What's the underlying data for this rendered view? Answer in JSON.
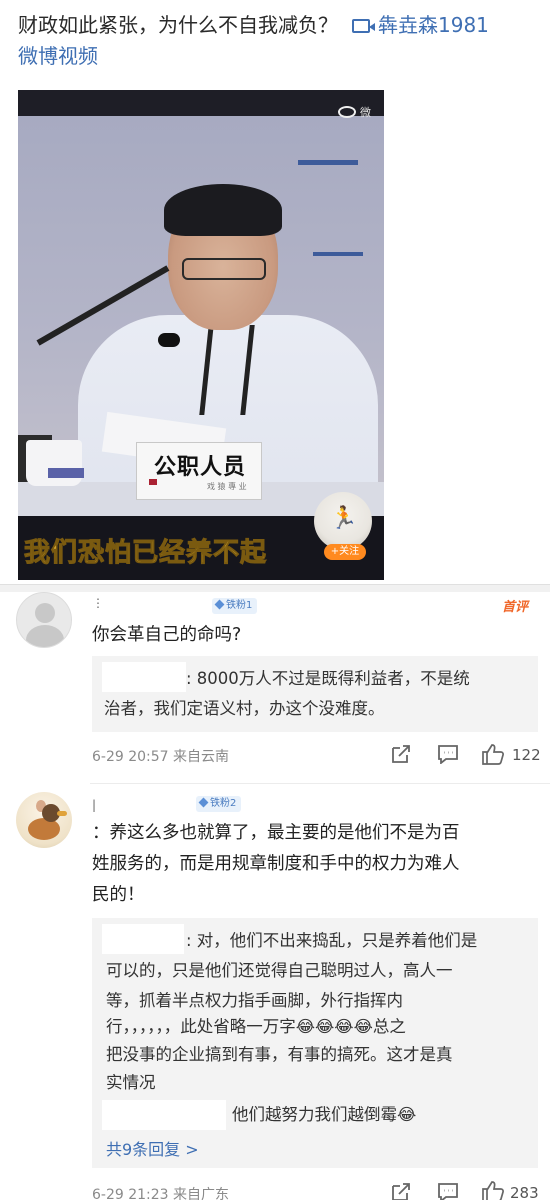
{
  "post": {
    "title": "财政如此紧张，为什么不自我减负？",
    "author": "犇垚森1981",
    "source": "微博视频",
    "video": {
      "watermark": "微",
      "nameplate": "公职人员",
      "nameplate_sub": "戏 猿 專 业",
      "subtitle": "我们恐怕已经养不起",
      "follow_label": "+关注"
    }
  },
  "hot_label": "首评",
  "comments": [
    {
      "author": "",
      "fan_badge": "铁粉1",
      "text": "你会革自己的命吗?",
      "reply": {
        "text_line1": ": 8000万人不过是既得利益者，不是统",
        "text_line2": "治者，我们定语义村，办这个没难度。"
      },
      "meta": "6-29 20:57  来自云南",
      "likes": "122"
    },
    {
      "author": "",
      "fan_badge": "铁粉2",
      "text_line1": "：养这么多也就算了，最主要的是他们不是为百",
      "text_line2": "姓服务的，而是用规章制度和手中的权力为难人",
      "text_line3": "民的！",
      "replies": [
        {
          "line1": ": 对，他们不出来捣乱，只是养着他们是",
          "line2": "可以的，只是他们还觉得自己聪明过人，高人一",
          "line3": "等，抓着半点权力指手画脚，外行指挥内",
          "line4": "行，，，，，，此处省略一万字😂😂😂😂总之",
          "line5": "把没事的企业搞到有事，有事的搞死。这才是真",
          "line6": "实情况"
        },
        {
          "line1": "他们越努力我们越倒霉😂"
        }
      ],
      "more_replies": "共9条回复 >",
      "meta": "6-29 21:23  来自广东",
      "likes": "283"
    }
  ],
  "icons": {
    "share": "share-icon",
    "comment": "comment-icon",
    "like": "thumbs-up-icon",
    "video_camera": "video-camera-icon"
  },
  "colors": {
    "link": "#3f6fb3",
    "hot": "#f0672a",
    "subtitle": "#f5c23a",
    "follow": "#ff8a1f"
  }
}
